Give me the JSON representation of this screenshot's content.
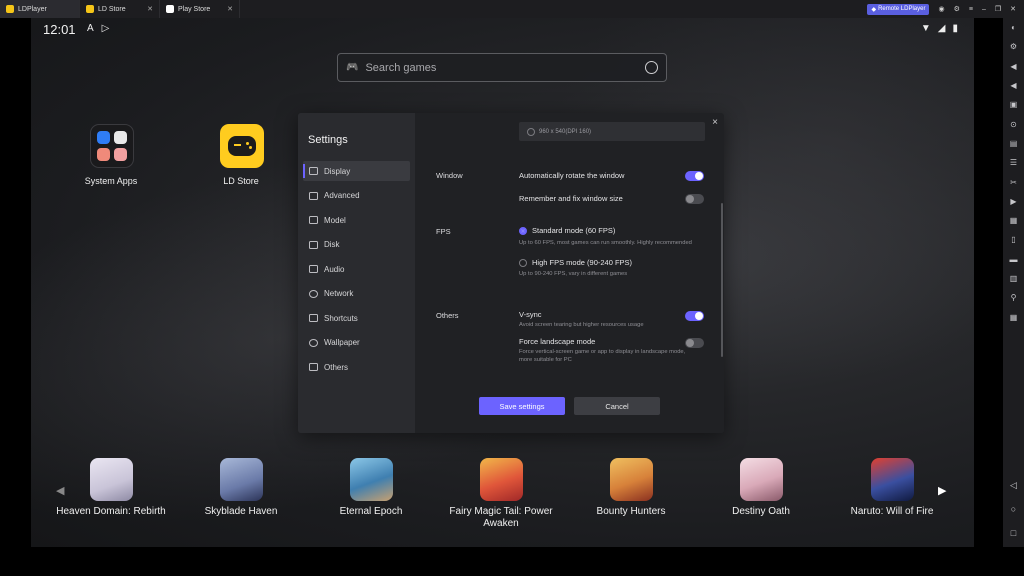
{
  "titlebar": {
    "tabs": [
      {
        "label": "LDPlayer",
        "color": "#f5c518"
      },
      {
        "label": "LD Store",
        "color": "#f5c518"
      },
      {
        "label": "Play Store",
        "color": "#ffffff"
      }
    ],
    "remote_label": "Remote LDPlayer",
    "icons": [
      "user-icon",
      "menu-icon",
      "hamburger-icon",
      "minimize-icon",
      "restore-icon",
      "close-icon"
    ],
    "glyphs": {
      "user": "◉",
      "settings": "⚙",
      "menu": "≡",
      "minimize": "–",
      "restore": "❐",
      "close": "✕",
      "tab_close": "✕",
      "remote": "◆"
    }
  },
  "status": {
    "time": "12:01",
    "left_glyphs": {
      "a": "A",
      "play": "▷"
    },
    "right_glyphs": {
      "wifi": "▼",
      "signal": "◢",
      "battery": "▮"
    }
  },
  "search": {
    "placeholder": "Search games",
    "glyph": "🎮"
  },
  "desktop": {
    "apps": [
      {
        "label": "System Apps"
      },
      {
        "label": "LD Store"
      }
    ]
  },
  "settings": {
    "title": "Settings",
    "close_glyph": "×",
    "nav": [
      {
        "label": "Display",
        "active": true
      },
      {
        "label": "Advanced"
      },
      {
        "label": "Model"
      },
      {
        "label": "Disk"
      },
      {
        "label": "Audio"
      },
      {
        "label": "Network"
      },
      {
        "label": "Shortcuts"
      },
      {
        "label": "Wallpaper"
      },
      {
        "label": "Others"
      }
    ],
    "resolution_option": "960 x 540(DPI 160)",
    "window_label": "Window",
    "auto_rotate": "Automatically rotate the window",
    "remember_size": "Remember and fix window size",
    "fps_label": "FPS",
    "standard_mode": "Standard mode (60 FPS)",
    "standard_desc": "Up to 60 FPS, most games can run smoothly. Highly recommended",
    "high_mode": "High FPS mode (90-240 FPS)",
    "high_desc": "Up to 90-240 FPS, vary in different games",
    "others_label": "Others",
    "vsync": "V-sync",
    "vsync_desc": "Avoid screen tearing but higher resources usage",
    "force_landscape": "Force landscape mode",
    "force_desc": "Force vertical-screen game or app to display in landscape mode, more suitable for PC",
    "save_label": "Save settings",
    "cancel_label": "Cancel",
    "toggles": {
      "auto_rotate": true,
      "remember_size": false,
      "vsync": true,
      "force_landscape": false
    },
    "accent": "#6c63ff"
  },
  "games": {
    "left_arrow": "◀",
    "right_arrow": "▶",
    "items": [
      {
        "name": "Heaven Domain: Rebirth",
        "color": "#c9c4d8"
      },
      {
        "name": "Skyblade Haven",
        "color": "#6a7aa8"
      },
      {
        "name": "Eternal Epoch",
        "color": "#3f7fb0"
      },
      {
        "name": "Fairy Magic Tail: Power Awaken",
        "color": "#e0563a"
      },
      {
        "name": "Bounty Hunters",
        "color": "#d7813a"
      },
      {
        "name": "Destiny Oath",
        "color": "#d9a9b8"
      },
      {
        "name": "Naruto: Will of Fire",
        "color": "#3a4fa0"
      }
    ]
  },
  "sidebar": {
    "items": [
      "◐",
      "⚙",
      "◀",
      "◀",
      "▣",
      "⊙",
      "▤",
      "☰",
      "✂",
      "▶",
      "▦",
      "▯",
      "▬",
      "▥",
      "⚲",
      "▦"
    ],
    "bottom": [
      "◁",
      "○",
      "□"
    ]
  }
}
